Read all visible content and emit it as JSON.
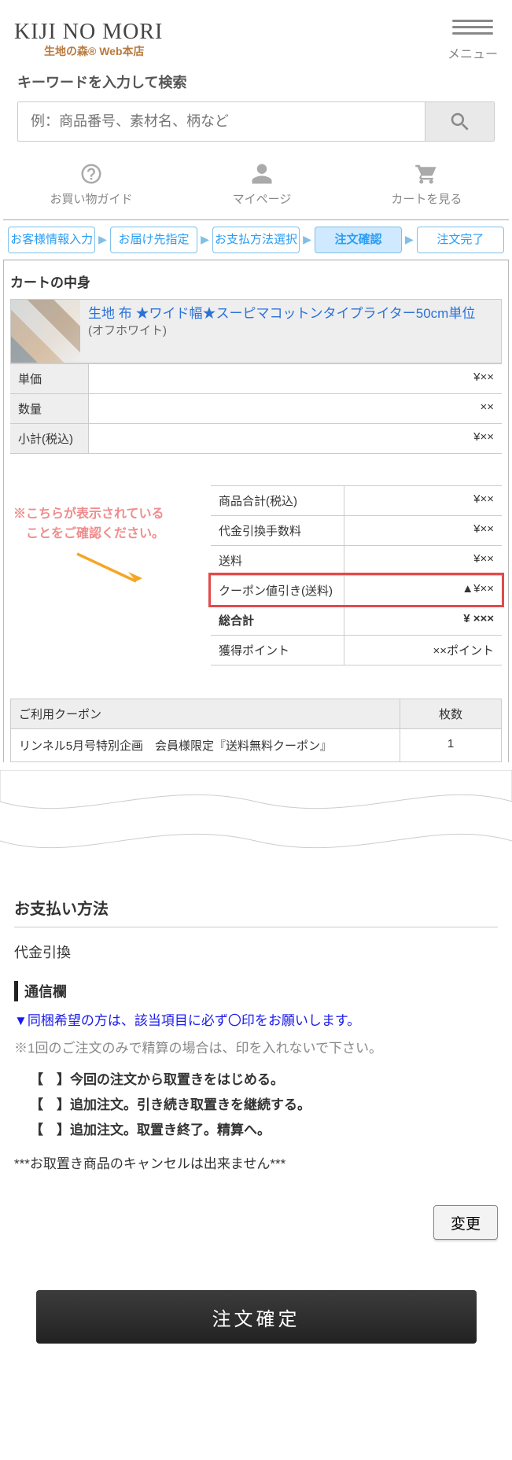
{
  "header": {
    "logo_main": "KIJI NO MORI",
    "logo_sub": "生地の森® Web本店",
    "menu_label": "メニュー"
  },
  "search": {
    "title": "キーワードを入力して検索",
    "placeholder": "例：商品番号、素材名、柄など"
  },
  "nav": {
    "guide": "お買い物ガイド",
    "mypage": "マイページ",
    "cart": "カートを見る"
  },
  "steps": {
    "s1": "お客様情報入力",
    "s2": "お届け先指定",
    "s3": "お支払方法選択",
    "s4": "注文確認",
    "s5": "注文完了"
  },
  "cart": {
    "title": "カートの中身",
    "product_name": "生地 布 ★ワイド幅★スーピマコットンタイプライター50cm単位",
    "variant": "(オフホワイト)",
    "rows": {
      "unit_price_k": "単価",
      "unit_price_v": "¥××",
      "qty_k": "数量",
      "qty_v": "××",
      "subtotal_k": "小計(税込)",
      "subtotal_v": "¥××"
    }
  },
  "callout": {
    "line1": "※こちらが表示されている",
    "line2": "　ことをご確認ください。"
  },
  "summary": {
    "item_total_k": "商品合計(税込)",
    "item_total_v": "¥××",
    "cod_fee_k": "代金引換手数料",
    "cod_fee_v": "¥××",
    "shipping_k": "送料",
    "shipping_v": "¥××",
    "coupon_k": "クーポン値引き(送料)",
    "coupon_v": "▲¥××",
    "grand_k": "総合計",
    "grand_v": "¥ ×××",
    "points_k": "獲得ポイント",
    "points_v": "××ポイント"
  },
  "coupon_used": {
    "head_name": "ご利用クーポン",
    "head_qty": "枚数",
    "row_name": "リンネル5月号特別企画　会員様限定『送料無料クーポン』",
    "row_qty": "1"
  },
  "payment": {
    "title": "お支払い方法",
    "method": "代金引換",
    "comm_title": "通信欄",
    "line_blue": "▼同梱希望の方は、該当項目に必ず〇印をお願いします。",
    "line_gray": "※1回のご注文のみで精算の場合は、印を入れないで下さい。",
    "opt1": "【　】今回の注文から取置きをはじめる。",
    "opt2": "【　】追加注文。引き続き取置きを継続する。",
    "opt3": "【　】追加注文。取置き終了。精算へ。",
    "cancel_note": "***お取置き商品のキャンセルは出来ません***"
  },
  "buttons": {
    "change": "変更",
    "confirm": "注文確定"
  }
}
